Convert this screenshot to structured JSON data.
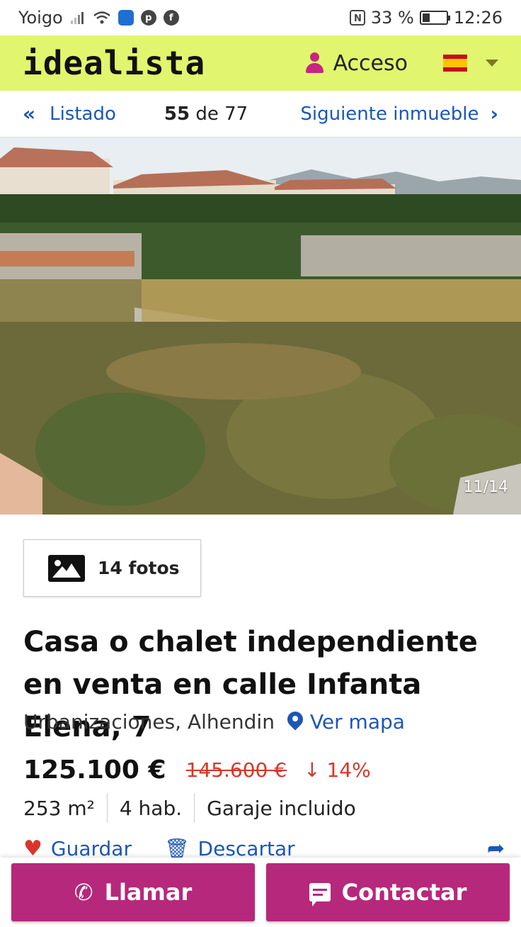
{
  "status_bar": {
    "carrier": "Yoigo",
    "battery_percent": "33 %",
    "battery_level": 0.33,
    "time": "12:26",
    "icons": [
      "signal-icon",
      "wifi-icon",
      "shield-icon",
      "pinterest-icon",
      "facebook-icon",
      "nfc-icon",
      "battery-icon"
    ]
  },
  "header": {
    "logo": "idealista",
    "login_label": "Acceso",
    "flag": "spain-flag-icon"
  },
  "nav": {
    "back_label": "Listado",
    "current_index": "55",
    "of_label": "de",
    "total": "77",
    "next_label": "Siguiente inmueble"
  },
  "gallery": {
    "counter": "11/14",
    "photos_button_label": "14 fotos"
  },
  "listing": {
    "title": "Casa o chalet independiente en venta en calle Infanta Elena, 7",
    "location": "Urbanizaciones, Alhendin",
    "map_link": "Ver mapa",
    "price": "125.100 €",
    "old_price": "145.600 €",
    "price_drop": "↓ 14%",
    "features": [
      "253 m²",
      "4 hab.",
      "Garaje incluido"
    ]
  },
  "actions": {
    "save_label": "Guardar",
    "discard_label": "Descartar"
  },
  "bottom_bar": {
    "call_label": "Llamar",
    "contact_label": "Contactar"
  },
  "colors": {
    "brand_yellow": "#e1f56e",
    "link_blue": "#1b57b8",
    "accent_magenta": "#b6287b",
    "price_drop_red": "#d9362b"
  }
}
